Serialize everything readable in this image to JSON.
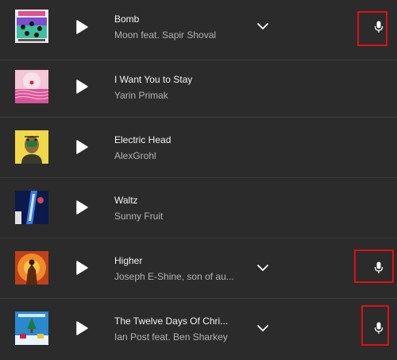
{
  "tracks": [
    {
      "title": "Bomb",
      "artist": "Moon feat. Sapir Shoval",
      "art_icon": "bomb-album-art",
      "has_lyrics_expand": true,
      "has_mic": true
    },
    {
      "title": "I Want You to Stay",
      "artist": "Yarin Primak",
      "art_icon": "pink-landscape-album-art",
      "has_lyrics_expand": false,
      "has_mic": false
    },
    {
      "title": "Electric Head",
      "artist": "AlexGrohl",
      "art_icon": "electric-head-album-art",
      "has_lyrics_expand": false,
      "has_mic": false
    },
    {
      "title": "Waltz",
      "artist": "Sunny Fruit",
      "art_icon": "waltz-album-art",
      "has_lyrics_expand": false,
      "has_mic": false
    },
    {
      "title": "Higher",
      "artist": "Joseph E-Shine, son of au...",
      "art_icon": "higher-album-art",
      "has_lyrics_expand": true,
      "has_mic": true
    },
    {
      "title": "The Twelve Days Of Chri...",
      "artist": "Ian Post feat. Ben Sharkey",
      "art_icon": "twelve-days-album-art",
      "has_lyrics_expand": true,
      "has_mic": true
    }
  ],
  "colors": {
    "background": "#2b2b2b",
    "divider": "#3b3b3b",
    "title": "#f2f2f2",
    "artist": "#b3b3b3",
    "highlight_box": "#e01010"
  }
}
